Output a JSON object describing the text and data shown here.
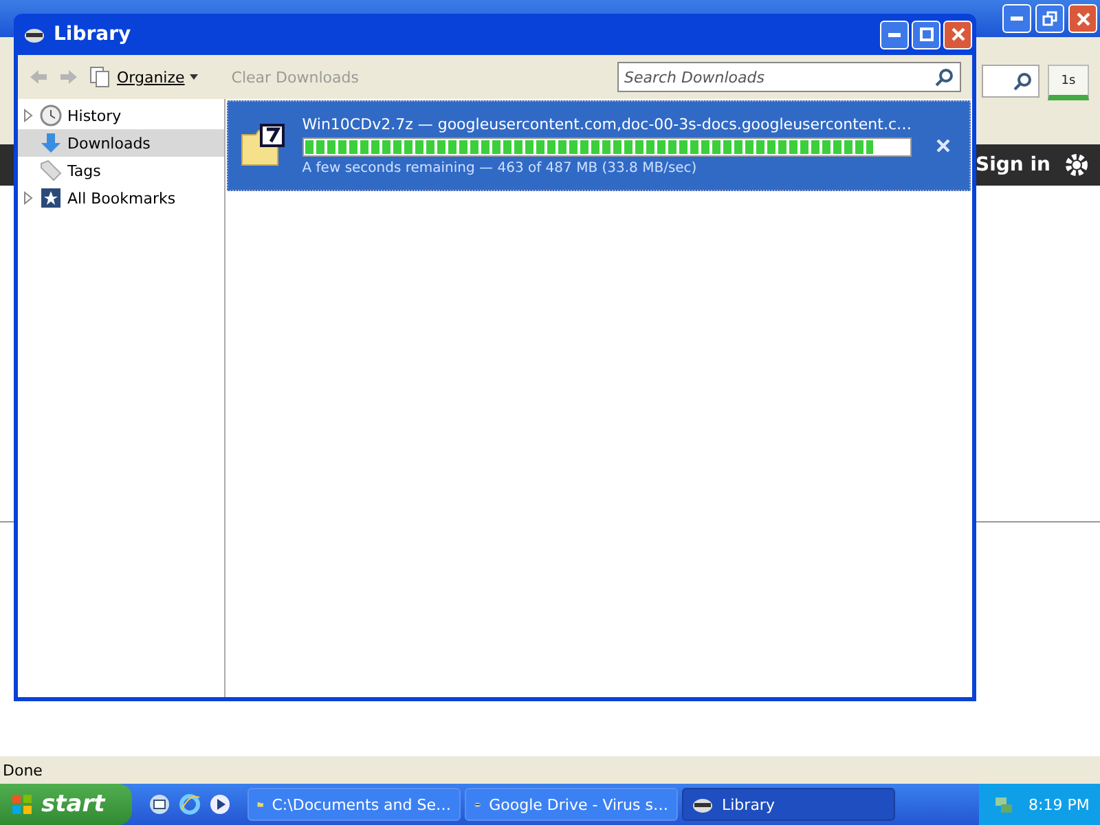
{
  "browser": {
    "toolbar_button": "1s",
    "sign_in": "Sign in",
    "status_bar": "Done"
  },
  "library_window": {
    "title": "Library",
    "toolbar": {
      "organize": "Organize",
      "clear_downloads": {
        "label": "Clear Downloads",
        "disabled": true
      },
      "search": {
        "placeholder": "Search Downloads"
      }
    },
    "sidebar": {
      "items": [
        {
          "label": "History",
          "kind": "history",
          "expandable": true,
          "selected": false
        },
        {
          "label": "Downloads",
          "kind": "downloads",
          "expandable": false,
          "selected": true
        },
        {
          "label": "Tags",
          "kind": "tags",
          "expandable": false,
          "selected": false
        },
        {
          "label": "All Bookmarks",
          "kind": "bookmarks",
          "expandable": true,
          "selected": false
        }
      ]
    },
    "downloads": [
      {
        "name": "Win10CDv2.7z — googleusercontent.com,doc-00-3s-docs.googleusercontent.c…",
        "status": "A few seconds remaining — 463 of 487 MB (33.8 MB/sec)",
        "level": 0.94,
        "selected": true
      }
    ]
  },
  "taskbar": {
    "start": "start",
    "tasks": [
      {
        "label": "C:\\Documents and Se…",
        "kind": "folder",
        "selected": false
      },
      {
        "label": "Google Drive - Virus s…",
        "kind": "browser",
        "selected": false
      },
      {
        "label": "Library",
        "kind": "browser",
        "selected": true
      }
    ],
    "clock": "8:19 PM"
  }
}
